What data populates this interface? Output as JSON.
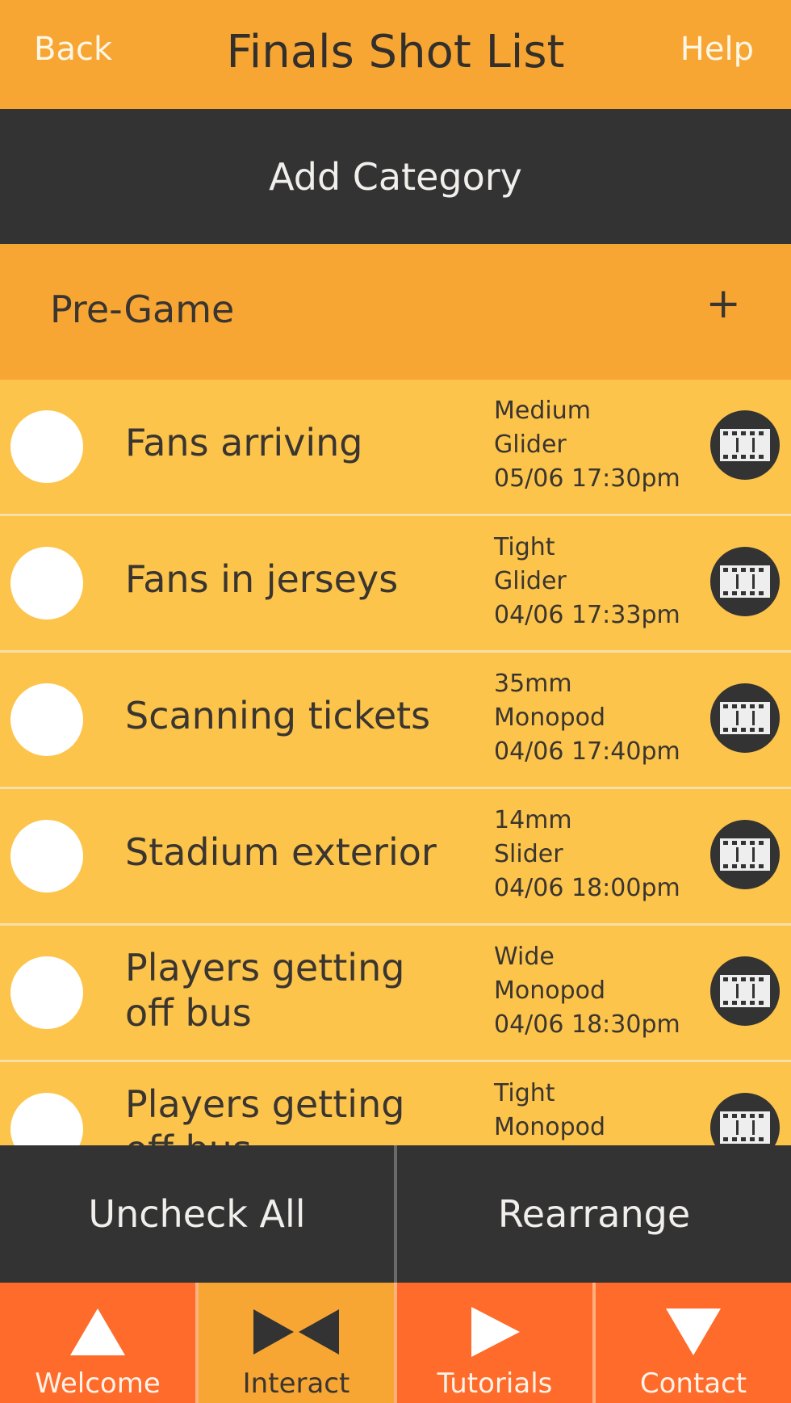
{
  "header": {
    "back_label": "Back",
    "title": "Finals Shot List",
    "help_label": "Help"
  },
  "add_category_label": "Add Category",
  "category": {
    "name": "Pre-Game",
    "add_icon": "plus-icon",
    "shots": [
      {
        "title": "Fans arriving",
        "lens": "Medium",
        "rig": "Glider",
        "datetime": "05/06 17:30pm",
        "checked": false
      },
      {
        "title": "Fans in jerseys",
        "lens": "Tight",
        "rig": "Glider",
        "datetime": "04/06 17:33pm",
        "checked": false
      },
      {
        "title": "Scanning tickets",
        "lens": "35mm",
        "rig": "Monopod",
        "datetime": "04/06 17:40pm",
        "checked": false
      },
      {
        "title": "Stadium exterior",
        "lens": "14mm",
        "rig": "Slider",
        "datetime": "04/06 18:00pm",
        "checked": false
      },
      {
        "title": "Players getting off bus",
        "lens": "Wide",
        "rig": "Monopod",
        "datetime": "04/06 18:30pm",
        "checked": false
      },
      {
        "title": "Players getting off bus",
        "lens": "Tight",
        "rig": "Monopod",
        "datetime": "",
        "checked": false
      }
    ]
  },
  "actions": {
    "uncheck_all_label": "Uncheck All",
    "rearrange_label": "Rearrange"
  },
  "tabs": [
    {
      "label": "Welcome",
      "icon": "triangle-up-icon",
      "active": false
    },
    {
      "label": "Interact",
      "icon": "bowtie-icon",
      "active": true
    },
    {
      "label": "Tutorials",
      "icon": "play-icon",
      "active": false
    },
    {
      "label": "Contact",
      "icon": "triangle-down-icon",
      "active": false
    }
  ],
  "colors": {
    "header_orange": "#F7A633",
    "row_yellow": "#FCC44A",
    "dark_bar": "#333333",
    "tab_orange": "#FE6B2B"
  }
}
